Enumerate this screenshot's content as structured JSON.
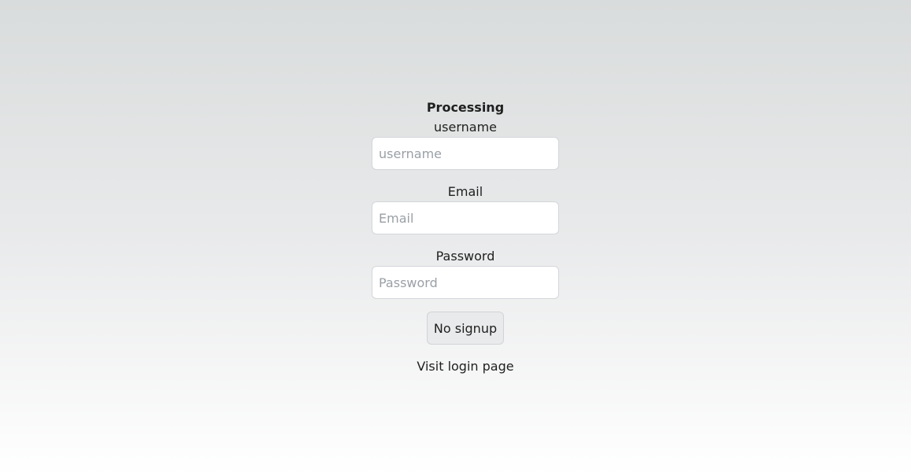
{
  "form": {
    "heading": "Processing",
    "username": {
      "label": "username",
      "value": "",
      "placeholder": "username"
    },
    "email": {
      "label": "Email",
      "value": "",
      "placeholder": "Email"
    },
    "password": {
      "label": "Password",
      "value": "",
      "placeholder": "Password"
    },
    "submit_label": "No signup",
    "login_link": "Visit login page"
  }
}
